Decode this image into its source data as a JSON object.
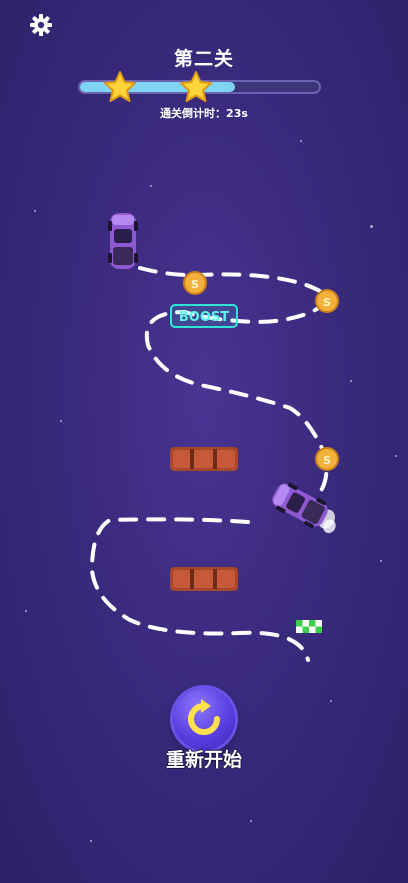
{
  "header": {
    "level_title": "第二关",
    "countdown": "通关倒计时：23s",
    "stars_earned": 2,
    "progress": 0.65
  },
  "board": {
    "boost_label": "BOOST",
    "coin_symbol": "S"
  },
  "footer": {
    "restart_label": "重新开始"
  },
  "icons": {
    "settings": "gear-icon",
    "restart": "restart-icon",
    "star": "star-icon",
    "finish": "checkered-flag-icon"
  },
  "colors": {
    "background": "#3a2a7d",
    "progress_fill": "#7fd3f4",
    "star": "#ffd43b",
    "coin": "#f4b13a",
    "boost": "#2fe6d6",
    "block": "#a8482a",
    "car": "#8e5ad1"
  }
}
